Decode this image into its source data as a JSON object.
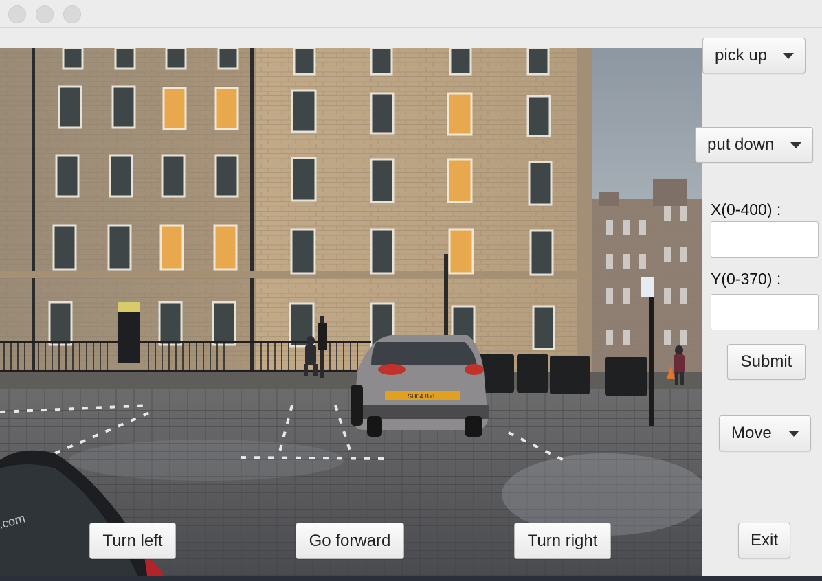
{
  "window": {
    "traffic_lights": [
      "close",
      "minimize",
      "zoom"
    ]
  },
  "scene": {
    "description_icon": "street-scene-photo",
    "sky_color": "#9aa3ab",
    "building_color": "#b7a187",
    "street_color": "#5a5b5e",
    "car_color": "#8c8a8c"
  },
  "controls": {
    "pick_up": "pick up",
    "put_down": "put down",
    "x_label": "X(0-400) :",
    "x_value": "",
    "y_label": "Y(0-370) :",
    "y_value": "",
    "submit": "Submit",
    "move": "Move",
    "exit": "Exit"
  },
  "navigation": {
    "turn_left": "Turn left",
    "go_forward": "Go forward",
    "turn_right": "Turn right"
  },
  "scene_text": {
    "plate": "SH04 BYL",
    "website": ".com"
  }
}
